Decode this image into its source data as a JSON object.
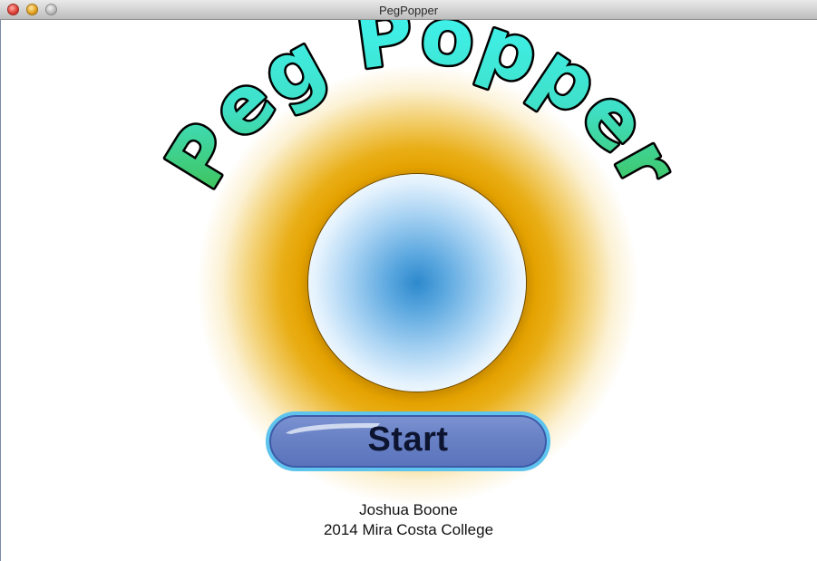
{
  "window": {
    "title": "PegPopper"
  },
  "logo": {
    "text": "Peg Popper"
  },
  "start": {
    "label": "Start"
  },
  "credits": {
    "author": "Joshua Boone",
    "affiliation": "2014 Mira Costa College"
  },
  "colors": {
    "logo_fill_top": "#3ff4f4",
    "logo_fill_bottom": "#3fbf4a",
    "glow": "#e4a200",
    "orb_center": "#2d89cc",
    "button_fill": "#6a83c6",
    "button_border": "#5ec4ee"
  },
  "icons": {
    "close": "close-window-icon",
    "minimize": "minimize-window-icon",
    "zoom": "zoom-window-icon"
  }
}
